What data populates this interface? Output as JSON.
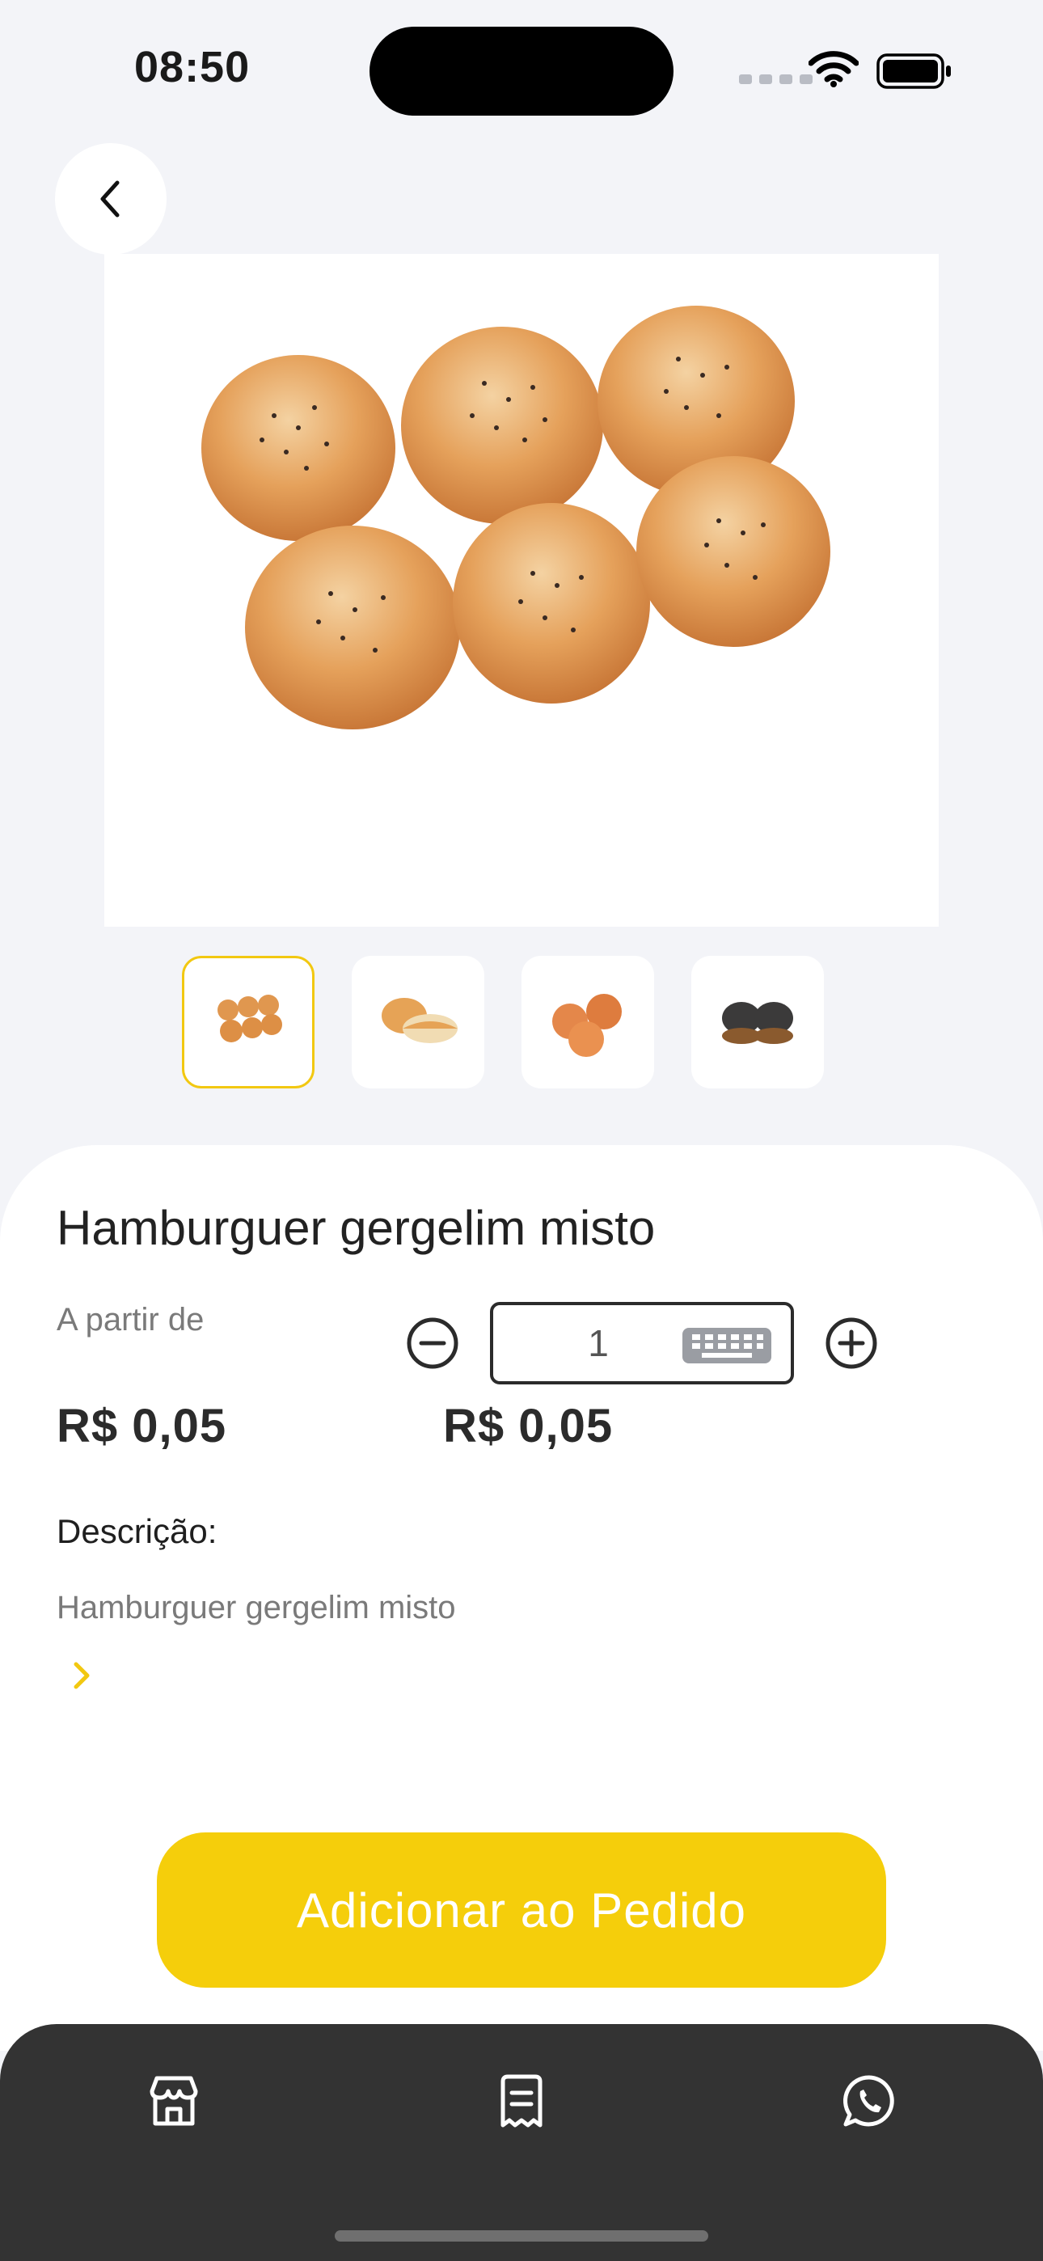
{
  "status_bar": {
    "time": "08:50"
  },
  "product": {
    "title": "Hamburguer gergelim misto",
    "from_label": "A partir de",
    "unit_price": "R$ 0,05",
    "total_price": "R$ 0,05",
    "quantity": "1"
  },
  "gallery": {
    "thumbnails": [
      {
        "icon": "buns-six-sesame-image",
        "active": true
      },
      {
        "icon": "bun-split-image",
        "active": false
      },
      {
        "icon": "buns-three-image",
        "active": false
      },
      {
        "icon": "buns-dark-image",
        "active": false
      }
    ]
  },
  "description": {
    "label": "Descrição:",
    "text": "Hamburguer gergelim misto"
  },
  "actions": {
    "add_to_order": "Adicionar ao Pedido"
  },
  "tabbar": {
    "items": [
      {
        "icon": "store-icon"
      },
      {
        "icon": "receipt-icon"
      },
      {
        "icon": "whatsapp-icon"
      }
    ]
  },
  "colors": {
    "accent": "#f5ce0b",
    "tabbar": "#333333",
    "background": "#f3f4f8"
  }
}
